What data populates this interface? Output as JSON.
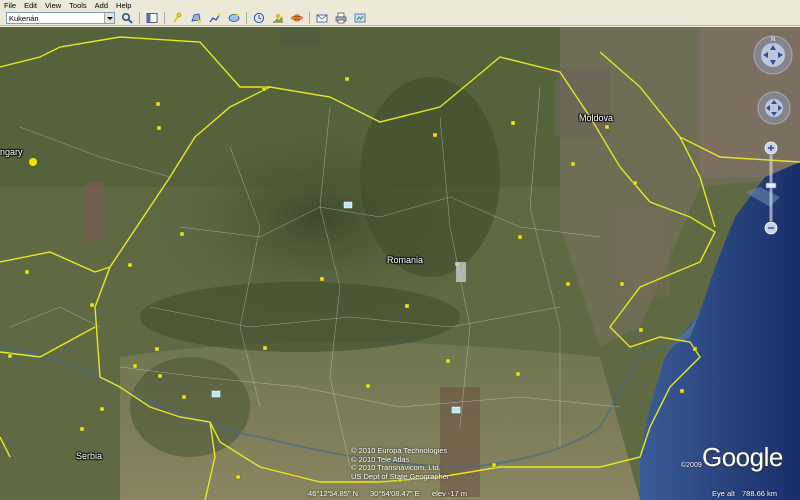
{
  "menu": {
    "file": "File",
    "edit": "Edit",
    "view": "View",
    "tools": "Tools",
    "add": "Add",
    "help": "Help"
  },
  "search": {
    "value": "Kukenán"
  },
  "toolbar_icons": [
    "search-icon",
    "sidebar-icon",
    "placemark-icon",
    "polygon-icon",
    "path-icon",
    "image-overlay-icon",
    "historical-imagery-icon",
    "sunlight-icon",
    "planets-icon",
    "email-icon",
    "print-icon",
    "show-in-maps-icon"
  ],
  "map": {
    "labels": {
      "romania": "Romania",
      "moldova": "Moldova",
      "hungary": "ngary",
      "serbia": "Serbia"
    },
    "copyright": {
      "line1": "© 2010 Europa Technologies",
      "line2": "© 2010 Tele Atlas",
      "line3": "© 2010 Transnavicom, Ltd.",
      "line4": "US Dept of State Geographer"
    },
    "status": {
      "latitude": "46°12'54.85\" N",
      "longitude": "30°54'08.47\" E",
      "elevation": "elev  -17 m",
      "eye_alt_label": "Eye alt",
      "eye_alt_value": "788.66 km"
    },
    "logo": "Google",
    "logo_year": "©2009"
  },
  "colors": {
    "border": "#e6e623",
    "sea": "#1f3a7a",
    "land": "#5b6642",
    "ui_bg": "#ece9d8"
  }
}
